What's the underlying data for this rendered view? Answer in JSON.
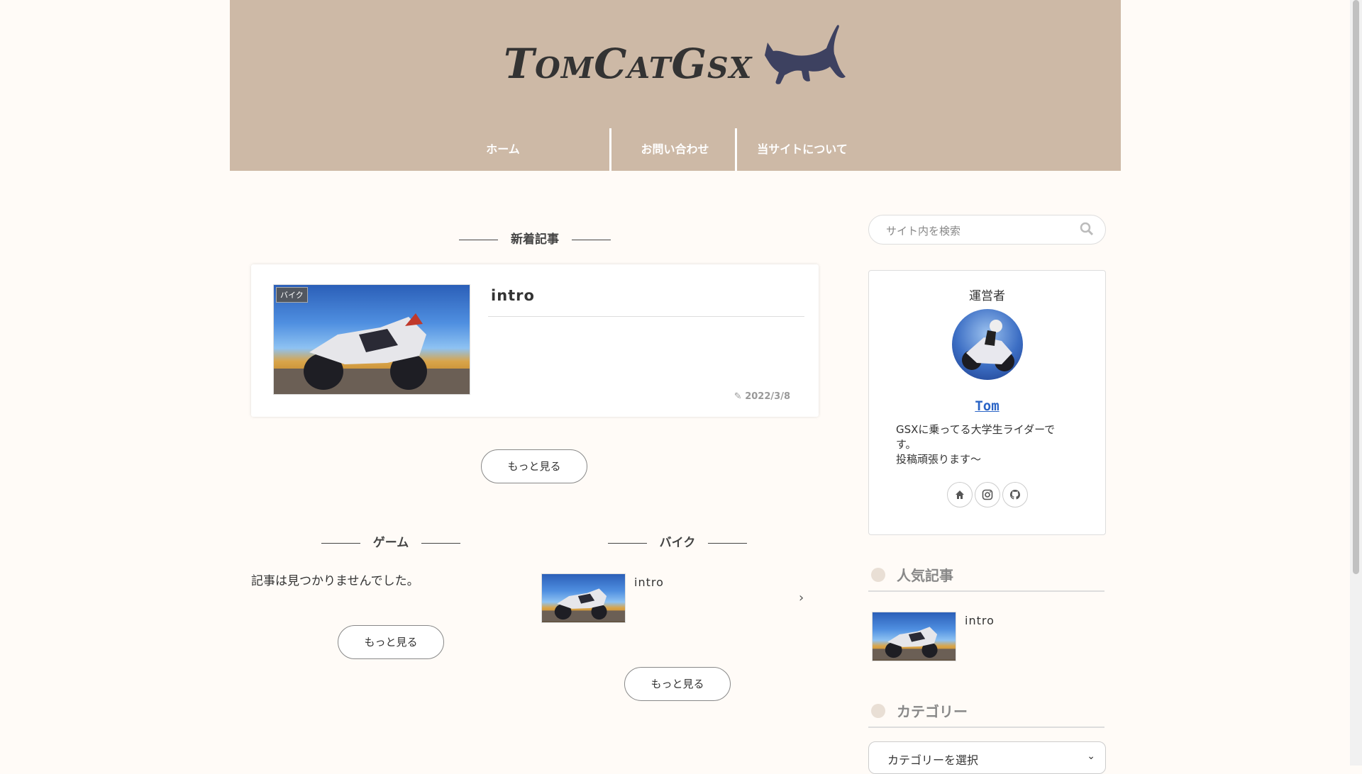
{
  "site": {
    "logo_text": "TomCatGsx",
    "nav": [
      "ホーム",
      "お問い合わせ",
      "当サイトについて"
    ]
  },
  "main": {
    "new_posts_title": "新着記事",
    "featured": {
      "category_tag": "バイク",
      "title": "intro",
      "date": "2022/3/8"
    },
    "more_label": "もっと見る",
    "game": {
      "title": "ゲーム",
      "empty_text": "記事は見つかりませんでした。",
      "more_label": "もっと見る"
    },
    "bike": {
      "title": "バイク",
      "post_title": "intro",
      "more_label": "もっと見る"
    }
  },
  "sidebar": {
    "search_placeholder": "サイト内を検索",
    "profile": {
      "heading": "運営者",
      "name": "Tom",
      "bio_line1": "GSXに乗ってる大学生ライダーで",
      "bio_line2": "す。",
      "bio_line3": "投稿頑張ります～",
      "social_icons": [
        "home-icon",
        "instagram-icon",
        "github-icon"
      ]
    },
    "popular": {
      "title": "人気記事",
      "post_title": "intro"
    },
    "category": {
      "title": "カテゴリー",
      "select_value": "カテゴリーを選択"
    }
  },
  "colors": {
    "header_bg": "#cdb9a6",
    "page_bg": "#fffbf7",
    "cat_logo": "#3d4160",
    "link": "#2a64c6"
  }
}
